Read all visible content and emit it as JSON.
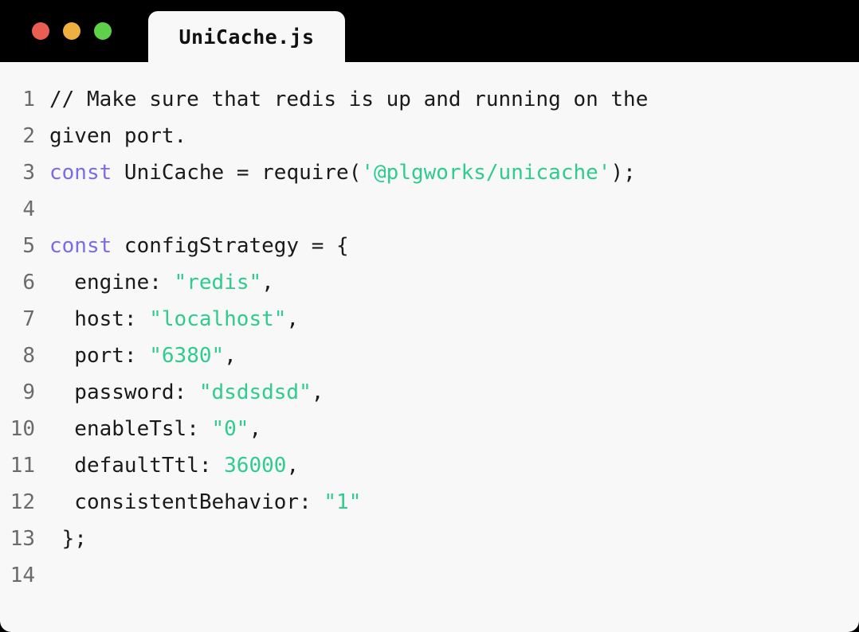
{
  "window": {
    "background": "#000000",
    "title_bar": {
      "traffic_lights": [
        {
          "name": "close",
          "color": "#EA5E52"
        },
        {
          "name": "minimize",
          "color": "#EFB03F"
        },
        {
          "name": "maximize",
          "color": "#5ED04A"
        }
      ],
      "tabs": [
        {
          "label": "UniCache.js",
          "active": true
        }
      ]
    }
  },
  "editor": {
    "background": "#F8F8F8",
    "gutter_color": "#6B6B6B",
    "syntax_colors": {
      "plain": "#1A1A1A",
      "comment": "#1A1A1A",
      "keyword": "#7C6BE8",
      "function": "#E04D2D",
      "string": "#2ECC8F",
      "number": "#2ECC8F",
      "property": "#DDA01A",
      "operator": "#2ECC8F",
      "punctuation": "#1A1A1A"
    },
    "lines": [
      {
        "number": "1",
        "tokens": [
          {
            "t": "// Make sure that redis is up and running on the",
            "c": "comment"
          }
        ]
      },
      {
        "number": "2",
        "tokens": [
          {
            "t": "given port.",
            "c": "comment"
          }
        ]
      },
      {
        "number": "3",
        "tokens": [
          {
            "t": "const",
            "c": "keyword"
          },
          {
            "t": " UniCache ",
            "c": "plain"
          },
          {
            "t": "=",
            "c": "operator"
          },
          {
            "t": " ",
            "c": "plain"
          },
          {
            "t": "require",
            "c": "function"
          },
          {
            "t": "(",
            "c": "punctuation"
          },
          {
            "t": "'@plgworks/unicache'",
            "c": "string"
          },
          {
            "t": ");",
            "c": "punctuation"
          }
        ]
      },
      {
        "number": "4",
        "tokens": []
      },
      {
        "number": "5",
        "tokens": [
          {
            "t": "const",
            "c": "keyword"
          },
          {
            "t": " configStrategy ",
            "c": "plain"
          },
          {
            "t": "=",
            "c": "plain"
          },
          {
            "t": " {",
            "c": "punctuation"
          }
        ]
      },
      {
        "number": "6",
        "tokens": [
          {
            "t": "  engine",
            "c": "property"
          },
          {
            "t": ": ",
            "c": "punctuation"
          },
          {
            "t": "\"redis\"",
            "c": "string"
          },
          {
            "t": ",",
            "c": "punctuation"
          }
        ]
      },
      {
        "number": "7",
        "tokens": [
          {
            "t": "  host",
            "c": "property"
          },
          {
            "t": ": ",
            "c": "punctuation"
          },
          {
            "t": "\"localhost\"",
            "c": "string"
          },
          {
            "t": ",",
            "c": "punctuation"
          }
        ]
      },
      {
        "number": "8",
        "tokens": [
          {
            "t": "  port",
            "c": "property"
          },
          {
            "t": ": ",
            "c": "punctuation"
          },
          {
            "t": "\"6380\"",
            "c": "string"
          },
          {
            "t": ",",
            "c": "punctuation"
          }
        ]
      },
      {
        "number": "9",
        "tokens": [
          {
            "t": "  password",
            "c": "property"
          },
          {
            "t": ": ",
            "c": "punctuation"
          },
          {
            "t": "\"dsdsdsd\"",
            "c": "string"
          },
          {
            "t": ",",
            "c": "punctuation"
          }
        ]
      },
      {
        "number": "10",
        "tokens": [
          {
            "t": "  enableTsl",
            "c": "property"
          },
          {
            "t": ": ",
            "c": "punctuation"
          },
          {
            "t": "\"0\"",
            "c": "string"
          },
          {
            "t": ",",
            "c": "punctuation"
          }
        ]
      },
      {
        "number": "11",
        "tokens": [
          {
            "t": "  defaultTtl",
            "c": "property"
          },
          {
            "t": ": ",
            "c": "punctuation"
          },
          {
            "t": "36000",
            "c": "number"
          },
          {
            "t": ",",
            "c": "punctuation"
          }
        ]
      },
      {
        "number": "12",
        "tokens": [
          {
            "t": "  consistentBehavior",
            "c": "property"
          },
          {
            "t": ": ",
            "c": "punctuation"
          },
          {
            "t": "\"1\"",
            "c": "string"
          }
        ]
      },
      {
        "number": "13",
        "tokens": [
          {
            "t": " };",
            "c": "punctuation"
          }
        ]
      },
      {
        "number": "14",
        "tokens": []
      }
    ]
  }
}
